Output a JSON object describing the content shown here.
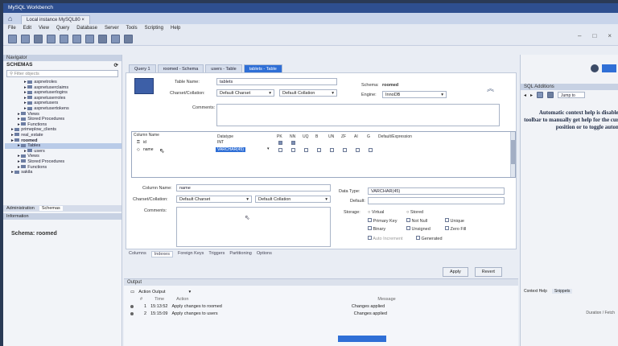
{
  "window": {
    "title": "MySQL Workbench",
    "connection_tab": "Local instance MySQL80",
    "close_glyph": "×"
  },
  "menu": [
    "File",
    "Edit",
    "View",
    "Query",
    "Database",
    "Server",
    "Tools",
    "Scripting",
    "Help"
  ],
  "window_controls": {
    "minimize": "–",
    "maximize": "□",
    "close": "×"
  },
  "sidebar": {
    "navigator_label": "Navigator",
    "schemas_label": "SCHEMAS",
    "filter_placeholder": "Filter objects",
    "tree": [
      {
        "label": "aspnetroles",
        "indent": 3,
        "icon": "table-icon"
      },
      {
        "label": "aspnetuserclaims",
        "indent": 3,
        "icon": "table-icon"
      },
      {
        "label": "aspnetuserlogins",
        "indent": 3,
        "icon": "table-icon"
      },
      {
        "label": "aspnetuserroles",
        "indent": 3,
        "icon": "table-icon"
      },
      {
        "label": "aspnetusers",
        "indent": 3,
        "icon": "table-icon"
      },
      {
        "label": "aspnetusertokens",
        "indent": 3,
        "icon": "table-icon"
      },
      {
        "label": "Views",
        "indent": 2,
        "icon": "views-icon"
      },
      {
        "label": "Stored Procedures",
        "indent": 2,
        "icon": "procedures-icon"
      },
      {
        "label": "Functions",
        "indent": 2,
        "icon": "functions-icon"
      },
      {
        "label": "primeplow_clients",
        "indent": 1,
        "icon": "schema-icon"
      },
      {
        "label": "real_estate",
        "indent": 1,
        "icon": "schema-icon"
      },
      {
        "label": "roomed",
        "indent": 1,
        "icon": "schema-icon",
        "bold": true
      },
      {
        "label": "Tables",
        "indent": 2,
        "icon": "tables-icon",
        "selected": true
      },
      {
        "label": "users",
        "indent": 3,
        "icon": "table-icon"
      },
      {
        "label": "Views",
        "indent": 2,
        "icon": "views-icon"
      },
      {
        "label": "Stored Procedures",
        "indent": 2,
        "icon": "procedures-icon"
      },
      {
        "label": "Functions",
        "indent": 2,
        "icon": "functions-icon"
      },
      {
        "label": "sakila",
        "indent": 1,
        "icon": "schema-icon"
      }
    ],
    "tabs": [
      "Administration",
      "Schemas"
    ],
    "info_label": "Information",
    "schema_info": "Schema: roomed"
  },
  "query_tabs": [
    "Query 1",
    "roomed - Schema",
    "users - Table",
    "tablets - Table"
  ],
  "editor": {
    "table_name_label": "Table Name:",
    "table_name_value": "tablets",
    "schema_label": "Schema:",
    "schema_value": "roomed",
    "charset_label": "Charset/Collation:",
    "charset_value": "Default Charset",
    "collation_value": "Default Collation",
    "engine_label": "Engine:",
    "engine_value": "InnoDB",
    "comments_label": "Comments:",
    "columns_header": [
      "Column Name",
      "Datatype",
      "PK",
      "NN",
      "UQ",
      "B",
      "UN",
      "ZF",
      "AI",
      "G",
      "Default/Expression"
    ],
    "columns": [
      {
        "name": "id",
        "type": "INT"
      },
      {
        "name": "name",
        "type": "VARCHAR(45)"
      }
    ],
    "detail": {
      "col_name_label": "Column Name:",
      "col_name_value": "name",
      "charset_label": "Charset/Collation:",
      "charset_value": "Default Charset",
      "collation_value": "Default Collation",
      "comments_label": "Comments:",
      "datatype_label": "Data Type:",
      "datatype_value": "VARCHAR(45)",
      "default_label": "Default:",
      "storage_label": "Storage:",
      "virtual": "Virtual",
      "stored": "Stored",
      "primary_key": "Primary Key",
      "not_null": "Not Null",
      "unique": "Unique",
      "binary": "Binary",
      "unsigned": "Unsigned",
      "zero_fill": "Zero Fill",
      "auto_increment": "Auto Increment",
      "generated": "Generated"
    },
    "bottom_tabs": [
      "Columns",
      "Indexes",
      "Foreign Keys",
      "Triggers",
      "Partitioning",
      "Options"
    ],
    "apply_label": "Apply",
    "revert_label": "Revert"
  },
  "output": {
    "label": "Output",
    "selector": "Action Output",
    "headers": [
      "#",
      "Time",
      "Action",
      "Message"
    ],
    "rows": [
      {
        "num": "1",
        "time": "15:13:52",
        "action": "Apply changes to roomed",
        "message": "Changes applied"
      },
      {
        "num": "2",
        "time": "15:15:09",
        "action": "Apply changes to users",
        "message": "Changes applied"
      }
    ],
    "duration_label": "Duration / Fetch"
  },
  "right_panel": {
    "title": "SQL Additions",
    "jump_label": "Jump to",
    "help_text": "Automatic context help is disabled. Use the toolbar to manually get help for the current caret position or to toggle automatic help.",
    "tabs": [
      "Context Help",
      "Snippets"
    ]
  }
}
